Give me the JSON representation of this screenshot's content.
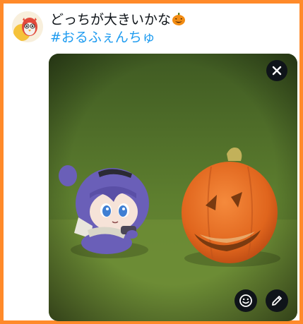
{
  "post": {
    "text": "どっちが大きいかな",
    "emoji": "jack-o-lantern-emoji",
    "hashtag": "#おるふぇんちゅ"
  },
  "media": {
    "description_icons": {
      "close": "close-icon",
      "sticker": "smiley-icon",
      "edit": "pencil-icon"
    }
  },
  "colors": {
    "frame_border": "#ff8a2a",
    "hashtag": "#1d9bf0",
    "button_bg": "#0f1419"
  }
}
